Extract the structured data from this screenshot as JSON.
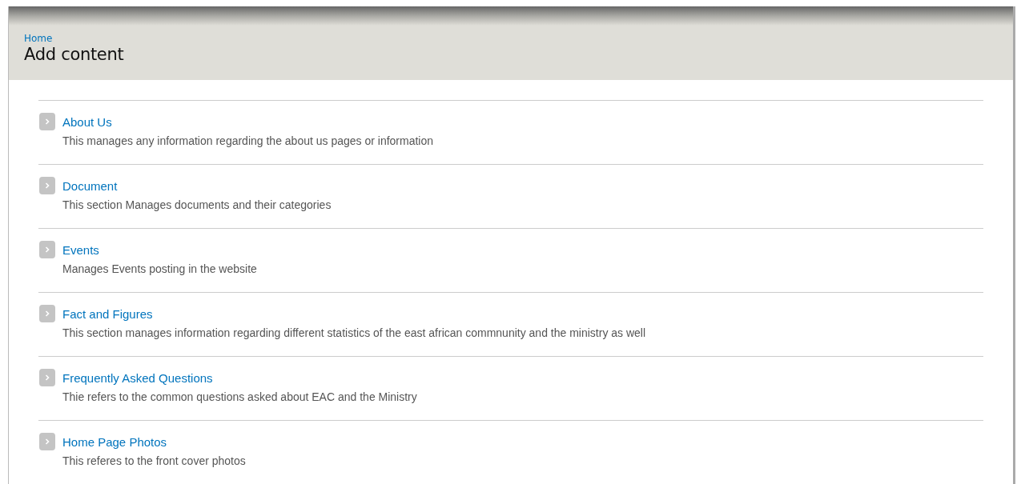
{
  "breadcrumb": [
    "Home"
  ],
  "title": "Add content",
  "content_types": [
    {
      "label": "About Us",
      "description": "This manages any information regarding the about us pages or information"
    },
    {
      "label": "Document",
      "description": "This section Manages documents and their categories"
    },
    {
      "label": "Events",
      "description": "Manages Events posting in the website"
    },
    {
      "label": "Fact and Figures",
      "description": "This section manages information regarding different statistics of the east african commnunity and the ministry as well"
    },
    {
      "label": "Frequently Asked Questions",
      "description": "Thie refers to the common questions asked about EAC and the Ministry"
    },
    {
      "label": "Home Page Photos",
      "description": "This referes to the front cover photos"
    }
  ]
}
